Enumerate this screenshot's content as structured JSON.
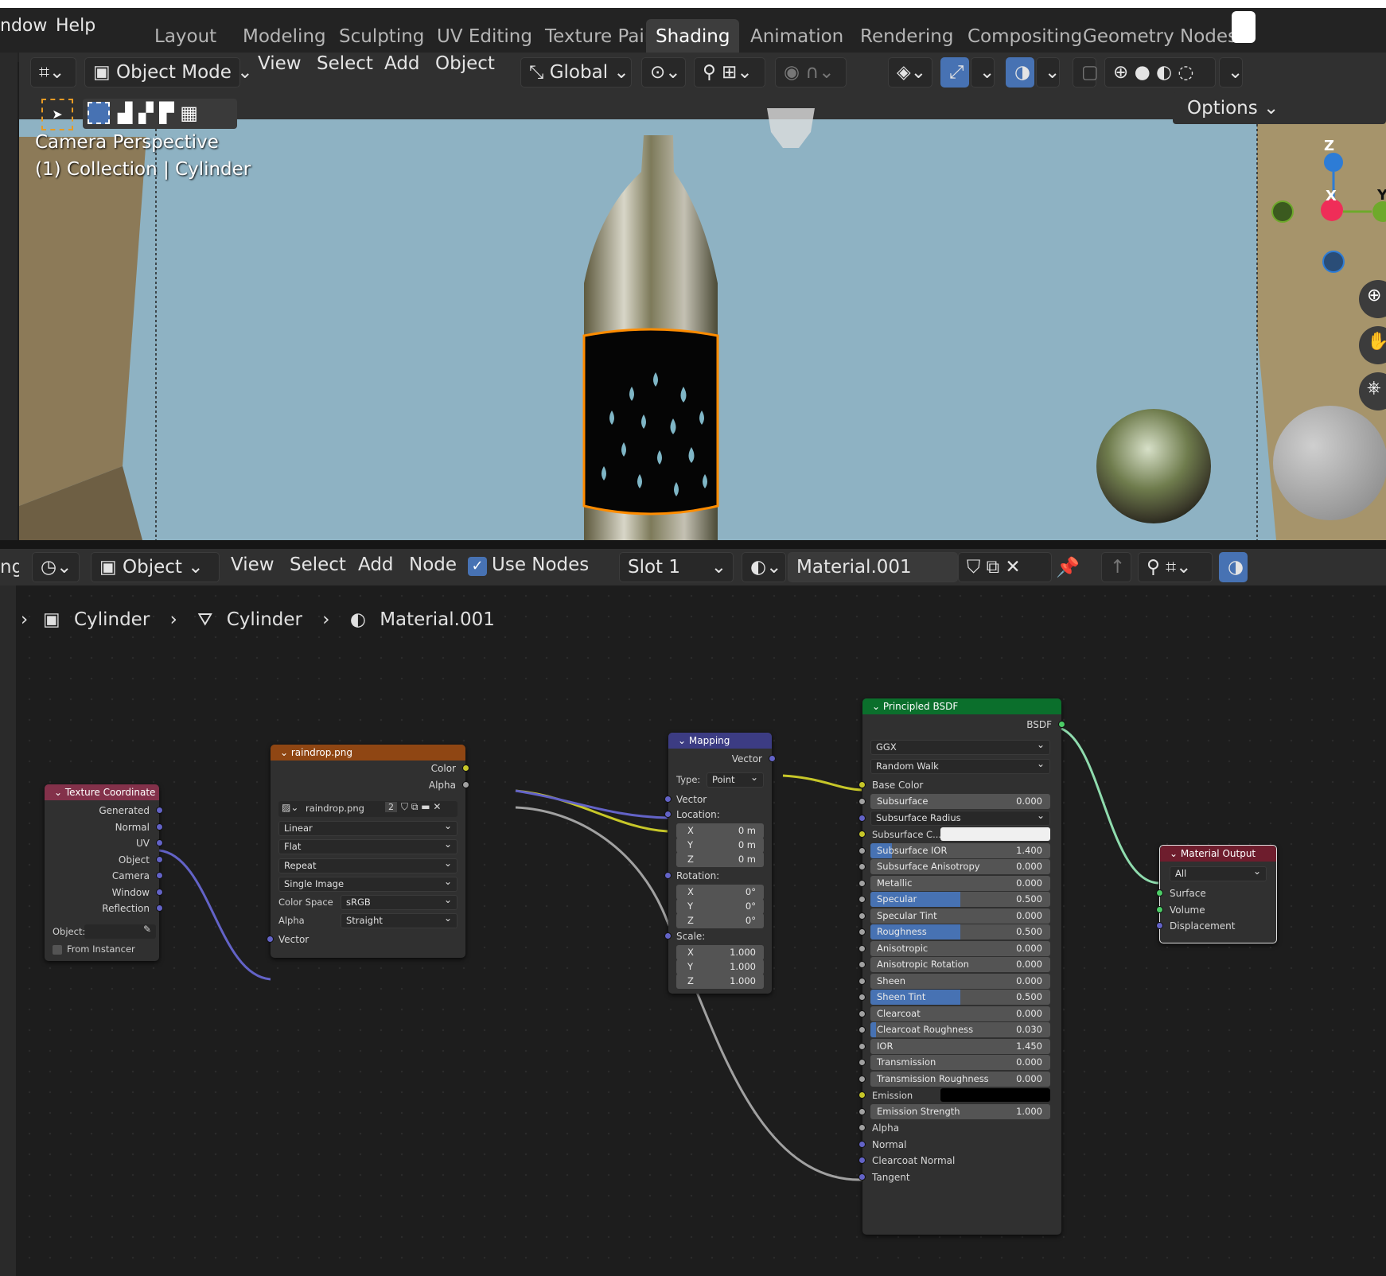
{
  "topmenu": {
    "window": "ndow",
    "help": "Help"
  },
  "workspaces": [
    "Layout",
    "Modeling",
    "Sculpting",
    "UV Editing",
    "Texture Paint",
    "Shading",
    "Animation",
    "Rendering",
    "Compositing",
    "Geometry Nodes"
  ],
  "viewport_header": {
    "mode": "Object Mode",
    "view": "View",
    "select": "Select",
    "add": "Add",
    "object": "Object",
    "orientation": "Global",
    "options": "Options"
  },
  "viewport": {
    "line1": "Camera Perspective",
    "line2": "(1) Collection | Cylinder",
    "gizmo": {
      "z": "Z",
      "y": "Y",
      "x": "X"
    }
  },
  "node_header": {
    "editor_label": "ng",
    "object": "Object",
    "view": "View",
    "select": "Select",
    "add": "Add",
    "node": "Node",
    "use_nodes": "Use Nodes",
    "slot": "Slot 1",
    "material": "Material.001"
  },
  "breadcrumb": {
    "object": "Cylinder",
    "mesh": "Cylinder",
    "material": "Material.001"
  },
  "nodes": {
    "texcoord": {
      "title": "Texture Coordinate",
      "outputs": [
        "Generated",
        "Normal",
        "UV",
        "Object",
        "Camera",
        "Window",
        "Reflection"
      ],
      "object_label": "Object:",
      "from_instancer": "From Instancer"
    },
    "image": {
      "title": "raindrop.png",
      "out_color": "Color",
      "out_alpha": "Alpha",
      "image_name": "raindrop.png",
      "users": "2",
      "interpolation": "Linear",
      "projection": "Flat",
      "extension": "Repeat",
      "source": "Single Image",
      "colorspace_label": "Color Space",
      "colorspace": "sRGB",
      "alpha_label": "Alpha",
      "alpha": "Straight",
      "in_vector": "Vector"
    },
    "mapping": {
      "title": "Mapping",
      "out_vector": "Vector",
      "type_label": "Type:",
      "type": "Point",
      "in_vector": "Vector",
      "location_label": "Location:",
      "location": [
        {
          "axis": "X",
          "value": "0 m"
        },
        {
          "axis": "Y",
          "value": "0 m"
        },
        {
          "axis": "Z",
          "value": "0 m"
        }
      ],
      "rotation_label": "Rotation:",
      "rotation": [
        {
          "axis": "X",
          "value": "0°"
        },
        {
          "axis": "Y",
          "value": "0°"
        },
        {
          "axis": "Z",
          "value": "0°"
        }
      ],
      "scale_label": "Scale:",
      "scale": [
        {
          "axis": "X",
          "value": "1.000"
        },
        {
          "axis": "Y",
          "value": "1.000"
        },
        {
          "axis": "Z",
          "value": "1.000"
        }
      ]
    },
    "bsdf": {
      "title": "Principled BSDF",
      "out": "BSDF",
      "distribution": "GGX",
      "subsurface_method": "Random Walk",
      "base_color": "Base Color",
      "fields": [
        {
          "label": "Subsurface",
          "value": "0.000",
          "fill": 0
        },
        {
          "label": "Subsurface Radius",
          "value": "",
          "fill": 0,
          "dropdown": true
        },
        {
          "label": "Subsurface C...",
          "value": "",
          "fill": 0,
          "color": "#f0f0f0"
        },
        {
          "label": "Subsurface IOR",
          "value": "1.400",
          "fill": 0.12
        },
        {
          "label": "Subsurface Anisotropy",
          "value": "0.000",
          "fill": 0
        },
        {
          "label": "Metallic",
          "value": "0.000",
          "fill": 0
        },
        {
          "label": "Specular",
          "value": "0.500",
          "fill": 0.5
        },
        {
          "label": "Specular Tint",
          "value": "0.000",
          "fill": 0
        },
        {
          "label": "Roughness",
          "value": "0.500",
          "fill": 0.5
        },
        {
          "label": "Anisotropic",
          "value": "0.000",
          "fill": 0
        },
        {
          "label": "Anisotropic Rotation",
          "value": "0.000",
          "fill": 0
        },
        {
          "label": "Sheen",
          "value": "0.000",
          "fill": 0
        },
        {
          "label": "Sheen Tint",
          "value": "0.500",
          "fill": 0.5
        },
        {
          "label": "Clearcoat",
          "value": "0.000",
          "fill": 0
        },
        {
          "label": "Clearcoat Roughness",
          "value": "0.030",
          "fill": 0.03
        },
        {
          "label": "IOR",
          "value": "1.450",
          "fill": 0
        },
        {
          "label": "Transmission",
          "value": "0.000",
          "fill": 0
        },
        {
          "label": "Transmission Roughness",
          "value": "0.000",
          "fill": 0
        },
        {
          "label": "Emission",
          "value": "",
          "fill": 0,
          "color": "#000000"
        },
        {
          "label": "Emission Strength",
          "value": "1.000",
          "fill": 0
        }
      ],
      "tail": [
        "Alpha",
        "Normal",
        "Clearcoat Normal",
        "Tangent"
      ]
    },
    "output": {
      "title": "Material Output",
      "target": "All",
      "inputs": [
        "Surface",
        "Volume",
        "Displacement"
      ]
    }
  },
  "colors": {
    "accent": "#4772b3",
    "texcoord_header": "#83314a",
    "image_header": "#8f4613",
    "mapping_header": "#3c3c83",
    "bsdf_header": "#0b6f2c",
    "output_header": "#6e1d2d",
    "selection": "#ff8c00"
  }
}
